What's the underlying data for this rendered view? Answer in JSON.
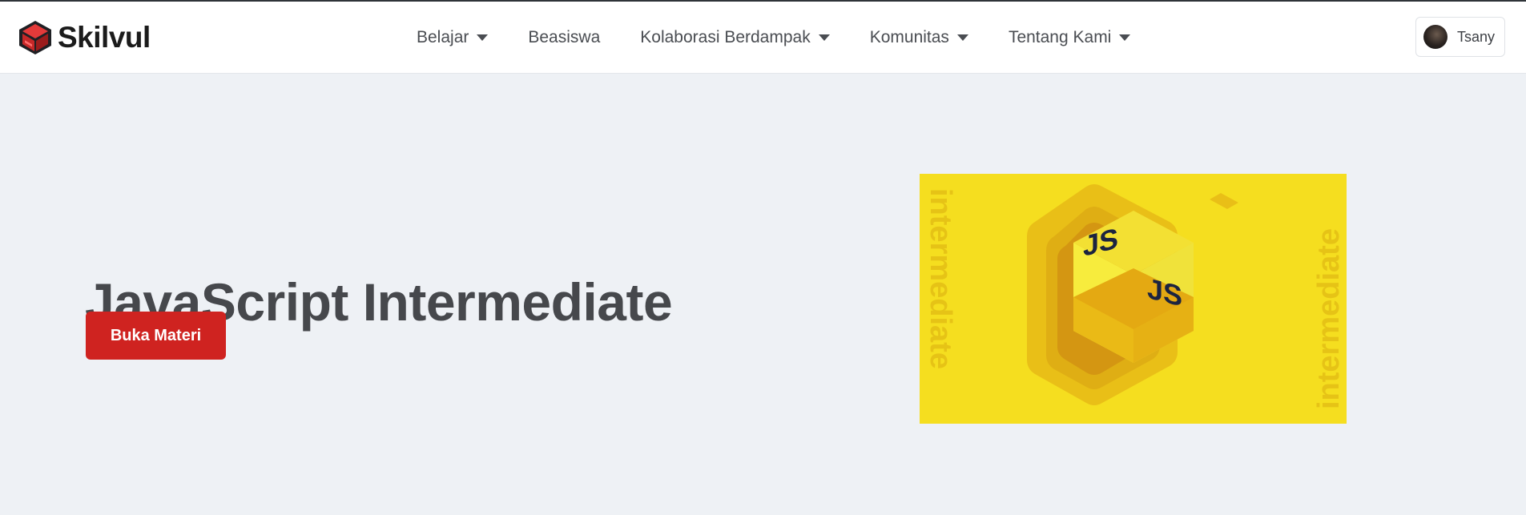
{
  "brand": {
    "name": "Skilvul",
    "logo_icon": "skilvul-cube-logo"
  },
  "nav": {
    "items": [
      {
        "label": "Belajar",
        "has_dropdown": true
      },
      {
        "label": "Beasiswa",
        "has_dropdown": false
      },
      {
        "label": "Kolaborasi Berdampak",
        "has_dropdown": true
      },
      {
        "label": "Komunitas",
        "has_dropdown": true
      },
      {
        "label": "Tentang Kami",
        "has_dropdown": true
      }
    ]
  },
  "user": {
    "name": "Tsany"
  },
  "hero": {
    "title": "JavaScript Intermediate",
    "cta_label": "Buka Materi"
  },
  "banner": {
    "side_text": "intermediate",
    "cube_label": "JS",
    "background_color": "#f5de1f"
  },
  "colors": {
    "accent": "#cf2320",
    "page_bg": "#eef1f5"
  }
}
